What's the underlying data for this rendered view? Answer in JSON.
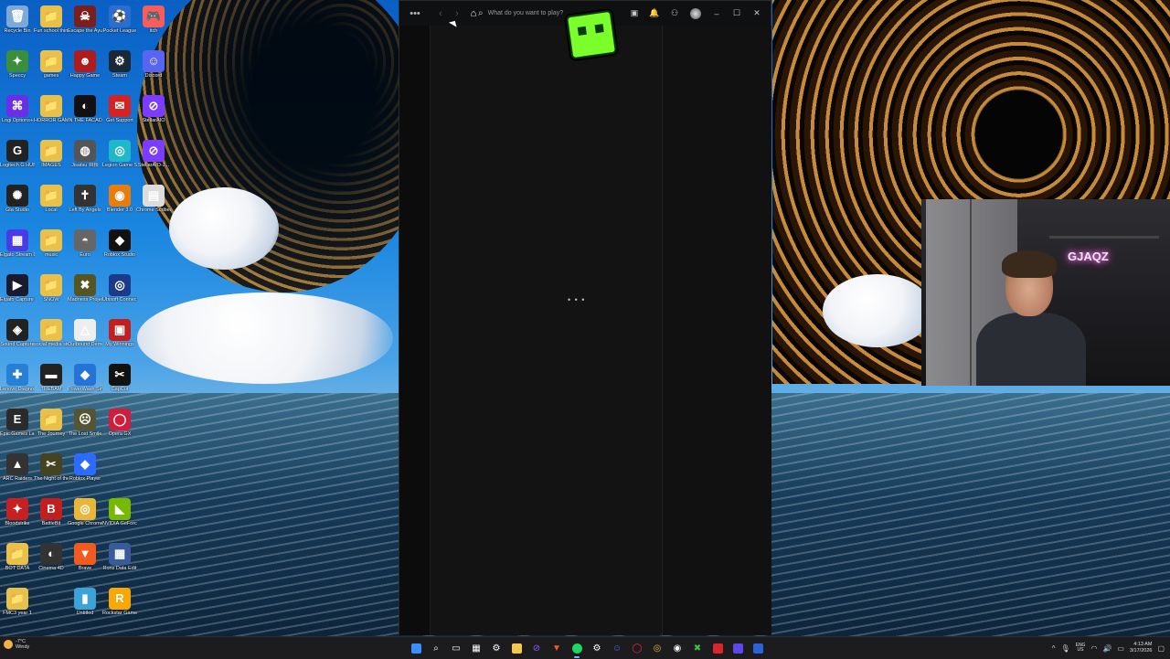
{
  "desktop": {
    "icons": [
      {
        "label": "Recycle Bin",
        "color": "#7ea9d6",
        "glyph": "🗑"
      },
      {
        "label": "Fun school things",
        "color": "#e9c14a",
        "glyph": "📁"
      },
      {
        "label": "Escape the Ayuwok",
        "color": "#7a1e1e",
        "glyph": "☠"
      },
      {
        "label": "Pocket League",
        "color": "#2a6fd0",
        "glyph": "⚽"
      },
      {
        "label": "itch",
        "color": "#fa5c5c",
        "glyph": "🎮"
      },
      {
        "label": "Speccy",
        "color": "#3b8e3b",
        "glyph": "✦"
      },
      {
        "label": "games",
        "color": "#e9c14a",
        "glyph": "📁"
      },
      {
        "label": "Happy Game",
        "color": "#b01c1c",
        "glyph": "☻"
      },
      {
        "label": "Steam",
        "color": "#1b2838",
        "glyph": "⚙"
      },
      {
        "label": "Discord",
        "color": "#5865f2",
        "glyph": "☺"
      },
      {
        "label": "Logi Options+",
        "color": "#6a2ee8",
        "glyph": "⌘"
      },
      {
        "label": "HORROR GAMES",
        "color": "#e9c14a",
        "glyph": "📁"
      },
      {
        "label": "IN THE FACADE",
        "color": "#111",
        "glyph": "◐"
      },
      {
        "label": "Get Support",
        "color": "#d32323",
        "glyph": "✉"
      },
      {
        "label": "StellarAIO",
        "color": "#7b3cff",
        "glyph": "⊘"
      },
      {
        "label": "Logitech G HUB",
        "color": "#222",
        "glyph": "G"
      },
      {
        "label": "IMAGES",
        "color": "#e9c14a",
        "glyph": "📁"
      },
      {
        "label": "Jisatsu 自殺",
        "color": "#555",
        "glyph": "◍"
      },
      {
        "label": "Legion Game Shop",
        "color": "#1fb8c8",
        "glyph": "◎"
      },
      {
        "label": "StellarAIO-J...",
        "color": "#7b3cff",
        "glyph": "⊘"
      },
      {
        "label": "Gta Studio",
        "color": "#222",
        "glyph": "✺"
      },
      {
        "label": "Local",
        "color": "#e9c14a",
        "glyph": "📁"
      },
      {
        "label": "Left By Angels",
        "color": "#333",
        "glyph": "✝"
      },
      {
        "label": "Blender 3.0",
        "color": "#e87d0d",
        "glyph": "◉"
      },
      {
        "label": "Chrome Scribes",
        "color": "#ddd",
        "glyph": "▤"
      },
      {
        "label": "Elgato Stream Deck",
        "color": "#4a3be8",
        "glyph": "▦"
      },
      {
        "label": "music",
        "color": "#e9c14a",
        "glyph": "📁"
      },
      {
        "label": "Euro",
        "color": "#666",
        "glyph": "◓"
      },
      {
        "label": "Roblox Studio",
        "color": "#111",
        "glyph": "◆"
      },
      {
        "label": "",
        "color": "rgba(0,0,0,0)",
        "glyph": ""
      },
      {
        "label": "Elgato Capture HD",
        "color": "#1a1a2e",
        "glyph": "▶"
      },
      {
        "label": "SNOW",
        "color": "#e9c14a",
        "glyph": "📁"
      },
      {
        "label": "Madness Project",
        "color": "#552",
        "glyph": "✖"
      },
      {
        "label": "Ubisoft Connect",
        "color": "#1d3a8a",
        "glyph": "◎"
      },
      {
        "label": "",
        "color": "rgba(0,0,0,0)",
        "glyph": ""
      },
      {
        "label": "Sound Capture",
        "color": "#222",
        "glyph": "◈"
      },
      {
        "label": "social media stuff",
        "color": "#e9c14a",
        "glyph": "📁"
      },
      {
        "label": "Outbound Demo",
        "color": "#eee",
        "glyph": "△"
      },
      {
        "label": "My Winnings",
        "color": "#c21f1f",
        "glyph": "▣"
      },
      {
        "label": "",
        "color": "rgba(0,0,0,0)",
        "glyph": ""
      },
      {
        "label": "Lenovo Diagnostics",
        "color": "#2680d6",
        "glyph": "✚"
      },
      {
        "label": "TREBAM",
        "color": "#222",
        "glyph": "▬"
      },
      {
        "label": "PowerWash Simulator",
        "color": "#2673d8",
        "glyph": "◆"
      },
      {
        "label": "CapCut",
        "color": "#111",
        "glyph": "✂"
      },
      {
        "label": "",
        "color": "rgba(0,0,0,0)",
        "glyph": ""
      },
      {
        "label": "Epic Games Launcher",
        "color": "#2b2b2b",
        "glyph": "E"
      },
      {
        "label": "The Journey",
        "color": "#e9c14a",
        "glyph": "📁"
      },
      {
        "label": "The Lost Smile",
        "color": "#553",
        "glyph": "☹"
      },
      {
        "label": "Opera GX",
        "color": "#d21c3c",
        "glyph": "◯"
      },
      {
        "label": "",
        "color": "rgba(0,0,0,0)",
        "glyph": ""
      },
      {
        "label": "ARC Raiders",
        "color": "#333",
        "glyph": "▲"
      },
      {
        "label": "The Night of the Scissors",
        "color": "#442",
        "glyph": "✂"
      },
      {
        "label": "Roblox Player",
        "color": "#2b6bff",
        "glyph": "◆"
      },
      {
        "label": "",
        "color": "rgba(0,0,0,0)",
        "glyph": ""
      },
      {
        "label": "",
        "color": "rgba(0,0,0,0)",
        "glyph": ""
      },
      {
        "label": "Bloodstrike",
        "color": "#c82020",
        "glyph": "✦"
      },
      {
        "label": "BattleBit",
        "color": "#c21f1f",
        "glyph": "B"
      },
      {
        "label": "Google Chrome",
        "color": "#e8b73a",
        "glyph": "◎"
      },
      {
        "label": "NVIDIA GeForce",
        "color": "#76b900",
        "glyph": "◣"
      },
      {
        "label": "",
        "color": "rgba(0,0,0,0)",
        "glyph": ""
      },
      {
        "label": "BOT DATA",
        "color": "#e9c14a",
        "glyph": "📁"
      },
      {
        "label": "Cinema 4D",
        "color": "#333",
        "glyph": "◐"
      },
      {
        "label": "Brave",
        "color": "#f35a1f",
        "glyph": "▼"
      },
      {
        "label": "Rons Data Edit",
        "color": "#3a5b9a",
        "glyph": "▦"
      },
      {
        "label": "",
        "color": "rgba(0,0,0,0)",
        "glyph": ""
      },
      {
        "label": "FMC3 year 1",
        "color": "#e9c14a",
        "glyph": "📁"
      },
      {
        "label": "",
        "color": "rgba(0,0,0,0)",
        "glyph": ""
      },
      {
        "label": "Untitled",
        "color": "#3ba3d8",
        "glyph": "▮"
      },
      {
        "label": "Rockstar Games",
        "color": "#f8a800",
        "glyph": "R"
      },
      {
        "label": "",
        "color": "rgba(0,0,0,0)",
        "glyph": ""
      }
    ]
  },
  "app": {
    "search_placeholder": "What do you want to play?",
    "loading_text": "• • •",
    "menu_icon": "more-dots-icon",
    "nav": {
      "back": "‹",
      "forward": "›"
    },
    "controls": {
      "minimize": "–",
      "maximize": "☐",
      "close": "✕"
    }
  },
  "webcam": {
    "neon_text": "GJAQZ"
  },
  "taskbar": {
    "weather": {
      "temp": "-7°C",
      "condition": "Windy"
    },
    "tray": {
      "language_line1": "ENG",
      "language_line2": "US",
      "time": "4:13 AM",
      "date": "3/17/2026"
    }
  },
  "colors": {
    "accent": "#1ed760",
    "window_bg": "#111213"
  }
}
